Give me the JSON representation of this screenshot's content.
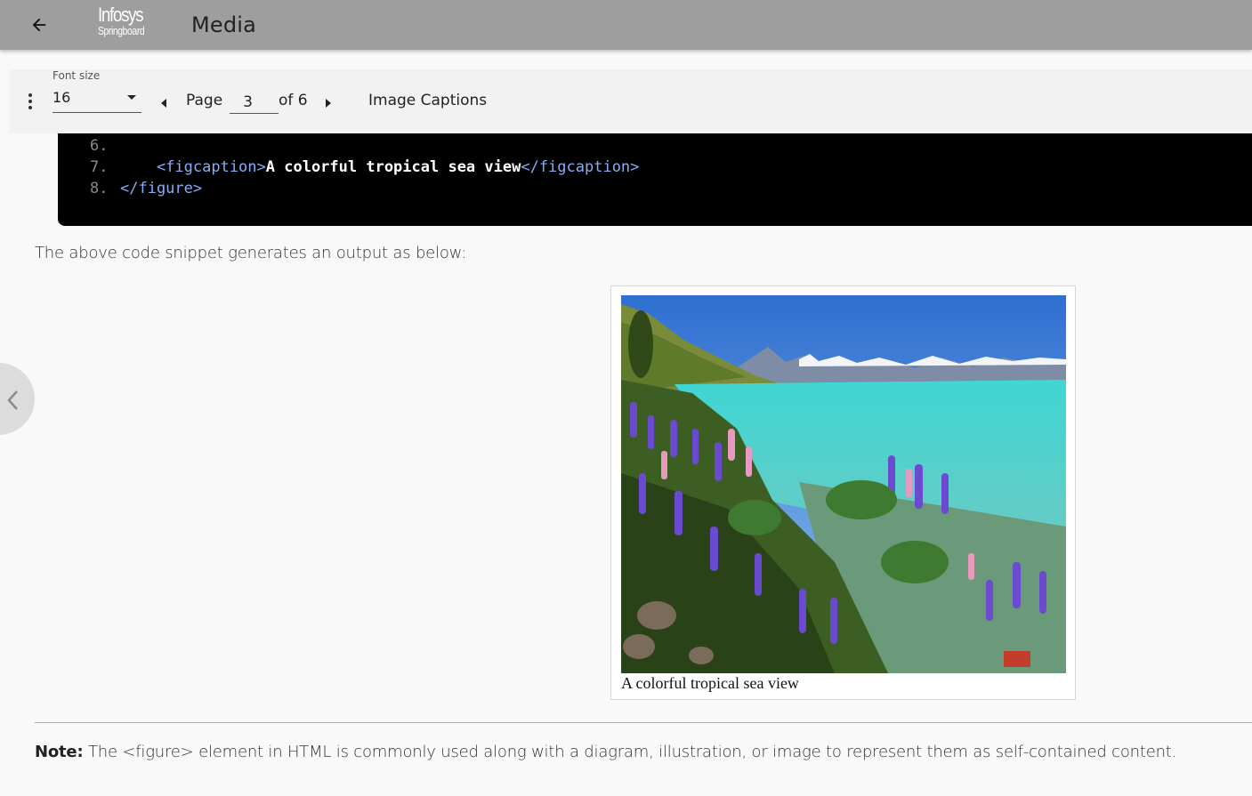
{
  "appbar": {
    "title": "Media",
    "logo_line1": "Infosys",
    "logo_line2": "Springboard"
  },
  "toolbar": {
    "font_size_label": "Font size",
    "font_size_value": "16",
    "page_label": "Page",
    "page_value": "3",
    "page_total": "of 6",
    "section_title": "Image Captions"
  },
  "code": {
    "lines": [
      {
        "num": "6.",
        "parts": []
      },
      {
        "num": "7.",
        "parts": [
          {
            "t": "    <figcaption>",
            "c": "tag"
          },
          {
            "t": "A colorful tropical sea view",
            "c": "txt"
          },
          {
            "t": "</figcaption>",
            "c": "tag"
          }
        ]
      },
      {
        "num": "8.",
        "parts": [
          {
            "t": "</figure>",
            "c": "tag"
          }
        ]
      }
    ]
  },
  "content": {
    "intro": "The above code snippet generates an output as below:",
    "figure_caption": "A colorful tropical sea view",
    "note_label": "Note:",
    "note_text": " The <figure> element in HTML is commonly used along with a diagram, illustration, or image to represent them as self-contained content."
  },
  "colors": {
    "appbar": "#9e9e9e",
    "code_bg": "#000000",
    "code_tag": "#86aef5"
  }
}
